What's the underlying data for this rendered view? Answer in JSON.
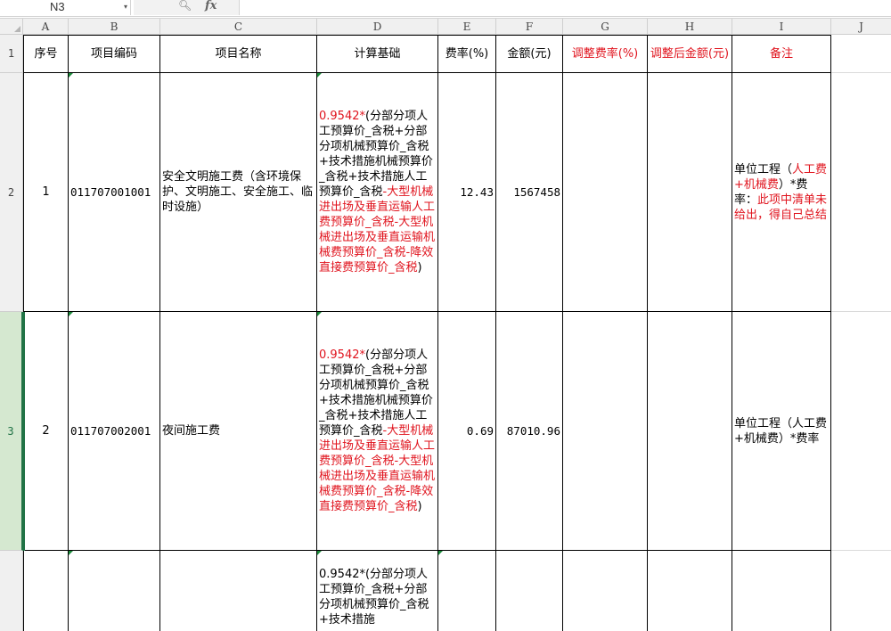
{
  "formula_bar": {
    "name_box": "N3",
    "zoom_icon": "zoom-icon",
    "fx_label": "fx",
    "formula": ""
  },
  "columns": [
    "A",
    "B",
    "C",
    "D",
    "E",
    "F",
    "G",
    "H",
    "I",
    "J"
  ],
  "rows": [
    "1",
    "2",
    "3"
  ],
  "header": {
    "seq": "序号",
    "code": "项目编码",
    "name": "项目名称",
    "basis": "计算基础",
    "rate": "费率(%)",
    "amount": "金额(元)",
    "adj_rate": "调整费率(%)",
    "adj_amount": "调整后金额(元)",
    "remark": "备注"
  },
  "data_rows": [
    {
      "seq": "1",
      "code": "011707001001",
      "name": "安全文明施工费（含环境保护、文明施工、安全施工、临时设施）",
      "basis_red_prefix": "0.9542*",
      "basis_black": "(分部分项人工预算价_含税+分部分项机械预算价_含税+技术措施机械预算价_含税+技术措施人工预算价_含税",
      "basis_red": "-大型机械进出场及垂直运输人工费预算价_含税-大型机械进出场及垂直运输机械费预算价_含税-降效直接费预算价_含税",
      "basis_end": ")",
      "rate": "12.43",
      "amount": "1567458",
      "adj_rate": "",
      "adj_amount": "",
      "remark_a": "单位工程（",
      "remark_b": "人工费+机械费",
      "remark_c": "）*费率：",
      "remark_d": "此项中清单未给出，得自己总结"
    },
    {
      "seq": "2",
      "code": "011707002001",
      "name": "夜间施工费",
      "basis_red_prefix": "0.9542*",
      "basis_black": "(分部分项人工预算价_含税+分部分项机械预算价_含税+技术措施机械预算价_含税+技术措施人工预算价_含税",
      "basis_red": "-大型机械进出场及垂直运输人工费预算价_含税-大型机械进出场及垂直运输机械费预算价_含税-降效直接费预算价_含税",
      "basis_end": ")",
      "rate": "0.69",
      "amount": "87010.96",
      "adj_rate": "",
      "adj_amount": "",
      "remark": "单位工程（人工费+机械费）*费率"
    },
    {
      "basis_partial": "0.9542*(分部分项人工预算价_含税+分部分项机械预算价_含税+技术措施"
    }
  ],
  "colors": {
    "red_text": "#e0141e",
    "selected_row_header": "#d5e8d0",
    "selection_border": "#217346"
  }
}
